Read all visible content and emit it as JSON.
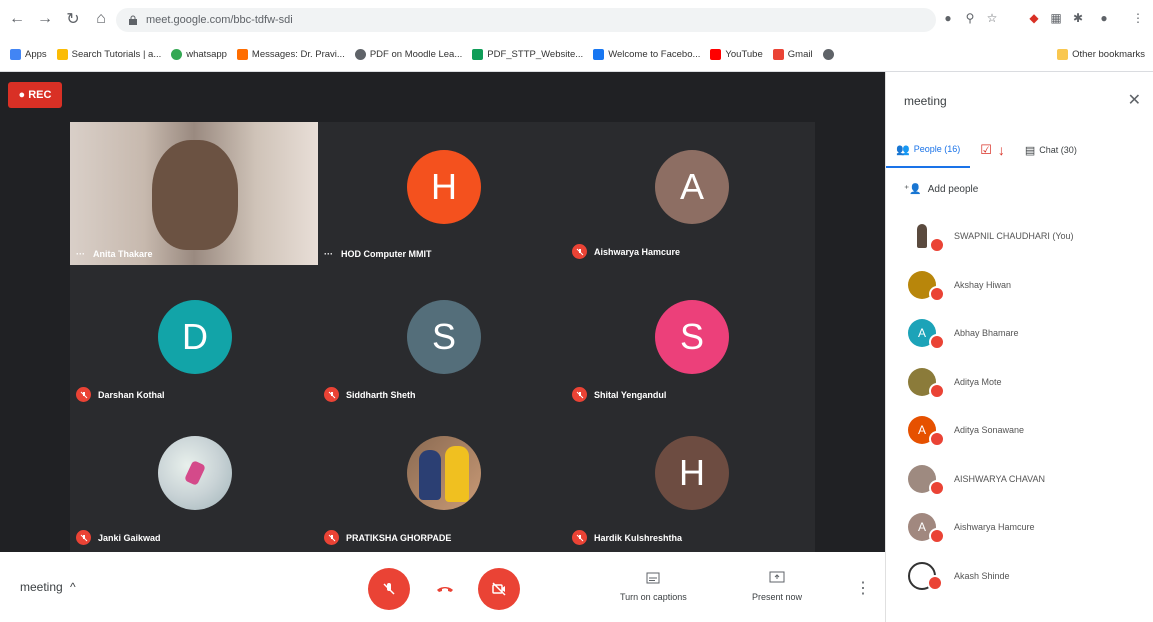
{
  "browser": {
    "url": "meet.google.com/bbc-tdfw-sdi",
    "bookmarks": [
      {
        "label": "Apps",
        "color": "#4285f4"
      },
      {
        "label": "Search Tutorials | a...",
        "color": "#fbbc05"
      },
      {
        "label": "whatsapp",
        "color": "#34a853"
      },
      {
        "label": "Messages: Dr. Pravi...",
        "color": "#ff6d00"
      },
      {
        "label": "PDF on Moodle Lea...",
        "color": "#5f6368"
      },
      {
        "label": "PDF_STTP_Website...",
        "color": "#0f9d58"
      },
      {
        "label": "Welcome to Facebo...",
        "color": "#1877f2"
      },
      {
        "label": "YouTube",
        "color": "#ff0000"
      },
      {
        "label": "Gmail",
        "color": "#ea4335"
      },
      {
        "label": "Other bookmarks",
        "color": "#f9c74f"
      }
    ]
  },
  "stage": {
    "rec_label": "REC",
    "tiles": [
      {
        "name": "Anita Thakare",
        "initial": "",
        "color": "#9e8a7e",
        "type": "video"
      },
      {
        "name": "HOD Computer MMIT",
        "initial": "H",
        "color": "#f4511e",
        "type": "avatar"
      },
      {
        "name": "Aishwarya Hamcure",
        "initial": "A",
        "color": "#8d6e63",
        "type": "avatar"
      },
      {
        "name": "Darshan Kothal",
        "initial": "D",
        "color": "#12a4a8",
        "type": "avatar"
      },
      {
        "name": "Siddharth Sheth",
        "initial": "S",
        "color": "#546e7a",
        "type": "avatar"
      },
      {
        "name": "Shital Yengandul",
        "initial": "S",
        "color": "#ec407a",
        "type": "avatar"
      },
      {
        "name": "Janki Gaikwad",
        "initial": "",
        "color": "#c9d3d6",
        "type": "photo"
      },
      {
        "name": "PRATIKSHA GHORPADE",
        "initial": "",
        "color": "#8a6a52",
        "type": "photo"
      },
      {
        "name": "Hardik Kulshreshtha",
        "initial": "H",
        "color": "#6d4c41",
        "type": "avatar"
      }
    ]
  },
  "bottom": {
    "meeting_label": "meeting",
    "captions_label": "Turn on captions",
    "present_label": "Present now"
  },
  "panel": {
    "title": "meeting",
    "tab_people": "People (16)",
    "tab_chat": "Chat (30)",
    "add_people": "Add people",
    "people": [
      {
        "name": "SWAPNIL CHAUDHARI (You)",
        "color": "#8a7a6a",
        "initial": ""
      },
      {
        "name": "Akshay Hiwan",
        "color": "#b8860b",
        "initial": ""
      },
      {
        "name": "Abhay Bhamare",
        "color": "#1ca3b8",
        "initial": "A"
      },
      {
        "name": "Aditya Mote",
        "color": "#8b7b3a",
        "initial": ""
      },
      {
        "name": "Aditya Sonawane",
        "color": "#e65100",
        "initial": "A"
      },
      {
        "name": "AISHWARYA CHAVAN",
        "color": "#9e8a80",
        "initial": ""
      },
      {
        "name": "Aishwarya Hamcure",
        "color": "#a1887f",
        "initial": "A"
      },
      {
        "name": "Akash Shinde",
        "color": "#ffffff",
        "initial": ""
      }
    ]
  }
}
